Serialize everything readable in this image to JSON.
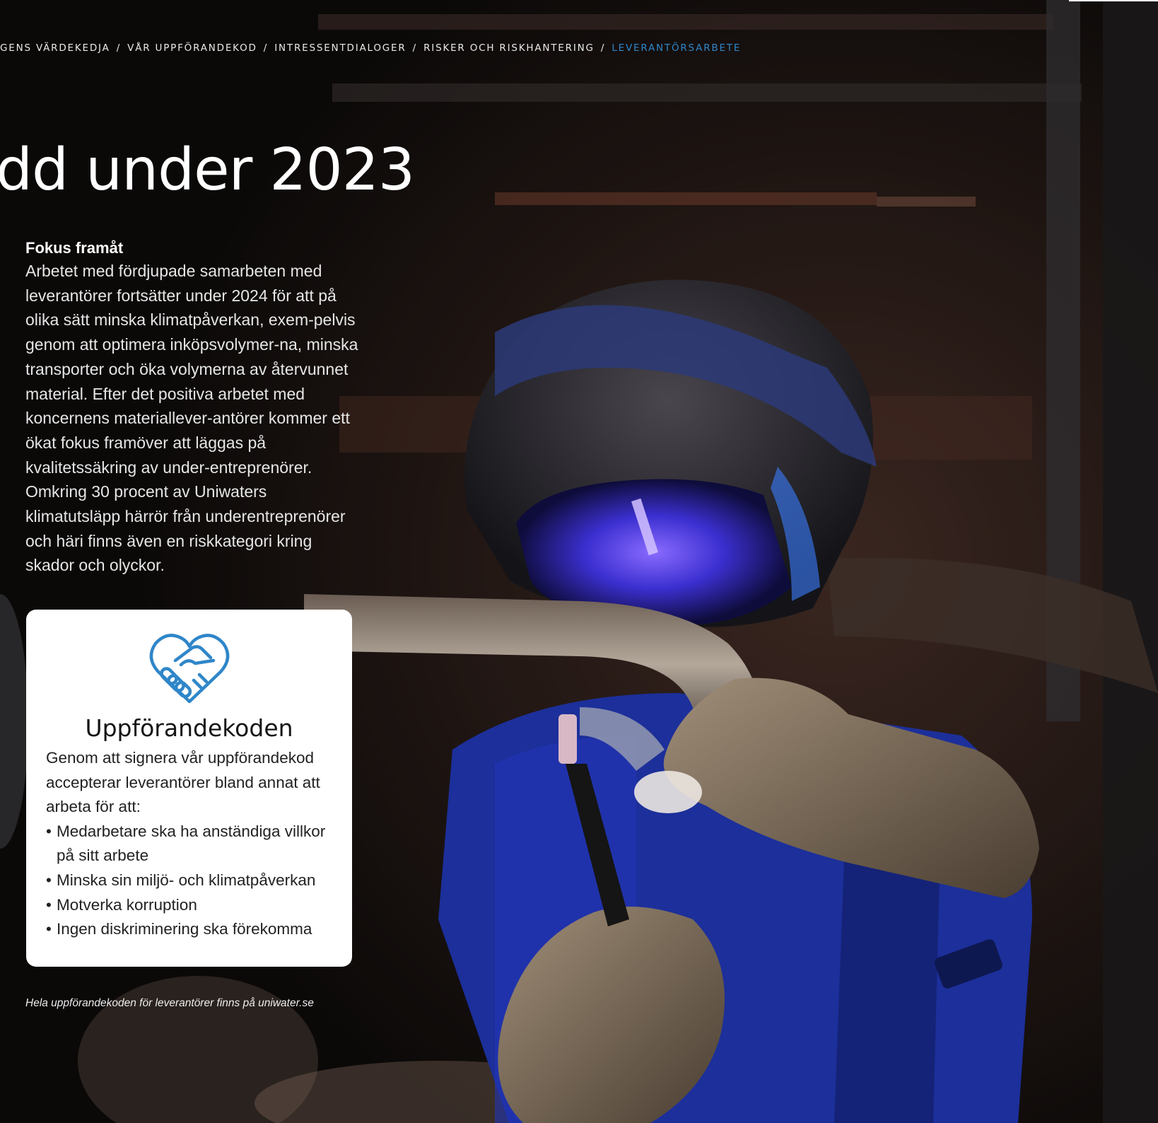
{
  "breadcrumb": {
    "items": [
      "GENS VÄRDEKEDJA",
      "VÅR UPPFÖRANDEKOD",
      "INTRESSENTDIALOGER",
      "RISKER OCH RISKHANTERING"
    ],
    "separator": "/",
    "current": "LEVERANTÖRSARBETE"
  },
  "heading": "dd under 2023",
  "fokus": {
    "title": "Fokus framåt",
    "body": "Arbetet med fördjupade samarbeten med leverantörer fortsätter under 2024 för att på olika sätt minska klimatpåverkan, exem-pelvis genom att optimera inköpsvolymer-na, minska transporter och öka volymerna av återvunnet material. Efter det positiva arbetet med koncernens materiallever-antörer kommer ett ökat fokus framöver att läggas på kvalitetssäkring av under-entreprenörer. Omkring 30 procent av Uniwaters klimatutsläpp härrör från underentreprenörer och häri finns även en riskkategori kring skador och olyckor."
  },
  "card": {
    "icon": "heart-handshake-icon",
    "title": "Uppförandekoden",
    "intro": "Genom att signera vår uppförandekod accepterar leverantörer bland annat att arbeta för att:",
    "bullets": [
      "Medarbetare ska ha anständiga villkor på sitt arbete",
      "Minska sin miljö- och klimatpåverkan",
      "Motverka korruption",
      "Ingen diskriminering ska förekomma"
    ]
  },
  "footnote": "Hela uppförandekoden för leverantörer finns på uniwater.se",
  "colors": {
    "accent": "#2f86c9",
    "background": "#0d0b0b",
    "card": "#ffffff",
    "workwear": "#1c2f9a"
  }
}
